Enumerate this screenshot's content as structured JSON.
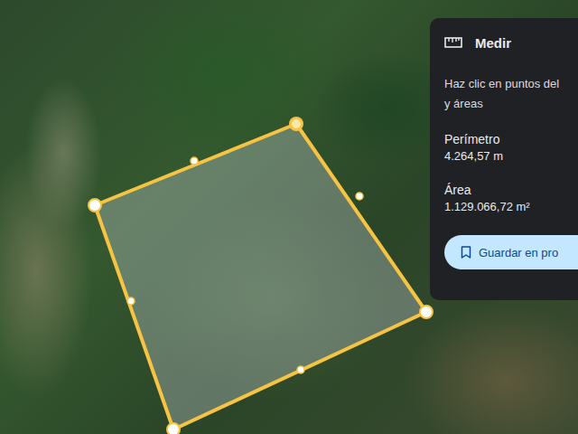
{
  "panel": {
    "title": "Medir",
    "hint_lines": [
      "Haz clic en puntos del",
      "y áreas"
    ],
    "stats": [
      {
        "label": "Perímetro",
        "value": "4.264,57 m"
      },
      {
        "label": "Área",
        "value": "1.129.066,72 m²"
      }
    ],
    "save_button": "Guardar en pro"
  },
  "polygon": {
    "vertices": [
      {
        "selected": true
      },
      {
        "selected": false
      },
      {
        "selected": false
      },
      {
        "selected": false
      }
    ]
  }
}
